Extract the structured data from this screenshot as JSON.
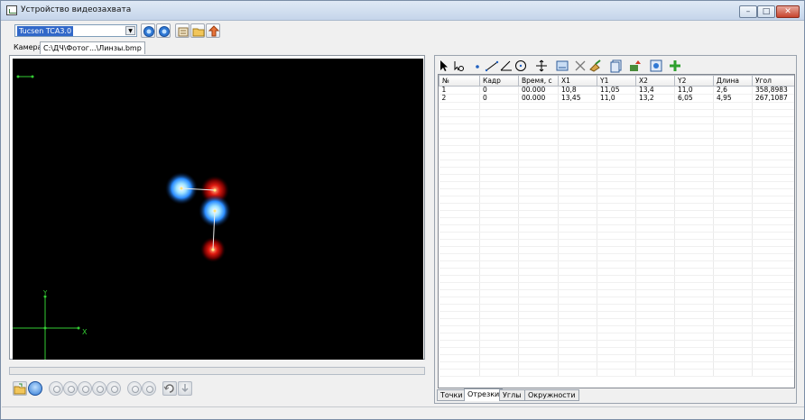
{
  "window": {
    "title": "Устройство видеозахвата",
    "min_glyph": "–",
    "max_glyph": "□",
    "close_glyph": "✕"
  },
  "toolbar": {
    "camera_select_value": "Tucsen TCA3.0",
    "buttons": [
      "connect-icon",
      "settings-icon",
      "properties-icon",
      "folder-icon",
      "snapshot-icon"
    ]
  },
  "tabs_top": {
    "camera": "Камера",
    "file": "С:\\ДЧ\\Фотог...\\Линзы.bmp"
  },
  "video": {
    "background": "#000000",
    "axis_x_label": "X",
    "axis_y_label": "Y",
    "point_color": "#33cc33"
  },
  "right_toolbar": {
    "tools": [
      "pointer-icon",
      "select-points-icon",
      "point-icon",
      "line-icon",
      "angle-icon",
      "circle-icon",
      "move-icon",
      "image-icon",
      "delete-icon",
      "clear-icon",
      "copy-icon",
      "export-icon",
      "calibrate-icon",
      "add-icon"
    ]
  },
  "table": {
    "columns": [
      "№",
      "Кадр",
      "Время, с",
      "X1",
      "Y1",
      "X2",
      "Y2",
      "Длина",
      "Угол"
    ],
    "rows": [
      [
        "1",
        "0",
        "00.000",
        "10,8",
        "11,05",
        "13,4",
        "11,0",
        "2,6",
        "358,8983"
      ],
      [
        "2",
        "0",
        "00.000",
        "13,45",
        "11,0",
        "13,2",
        "6,05",
        "4,95",
        "267,1087"
      ]
    ]
  },
  "tabs_bottom": {
    "points": "Точки",
    "segments": "Отрезки",
    "angles": "Углы",
    "circles": "Окружности",
    "active": "segments"
  }
}
